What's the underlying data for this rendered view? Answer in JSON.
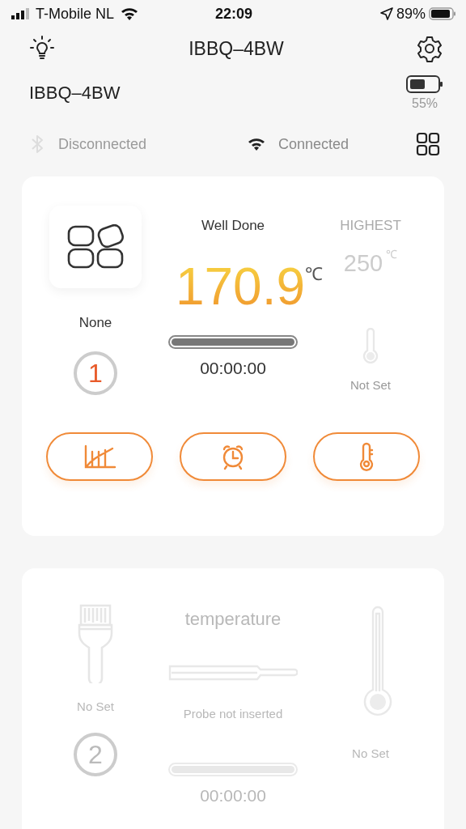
{
  "status_bar": {
    "carrier": "T-Mobile NL",
    "time": "22:09",
    "battery": "89%"
  },
  "header": {
    "title": "IBBQ–4BW"
  },
  "device": {
    "name": "IBBQ–4BW",
    "battery": "55%"
  },
  "connections": [
    {
      "kind": "bluetooth",
      "label": "Disconnected",
      "connected": false
    },
    {
      "kind": "wifi",
      "label": "Connected",
      "connected": true
    }
  ],
  "probes": [
    {
      "kind": "active",
      "number": "1",
      "food": "None",
      "doneness": "Well Done",
      "temperature": "170.9",
      "unit": "℃",
      "highest_label": "HIGHEST",
      "highest": "250",
      "highest_unit": "℃",
      "timer": "00:00:00",
      "target": "Not Set",
      "actions": [
        {
          "kind": "chart"
        },
        {
          "kind": "alarm"
        },
        {
          "kind": "thermometer"
        }
      ]
    },
    {
      "kind": "empty",
      "number": "2",
      "food": "No Set",
      "title": "temperature",
      "status": "Probe not inserted",
      "timer": "00:00:00",
      "target": "No Set"
    }
  ]
}
